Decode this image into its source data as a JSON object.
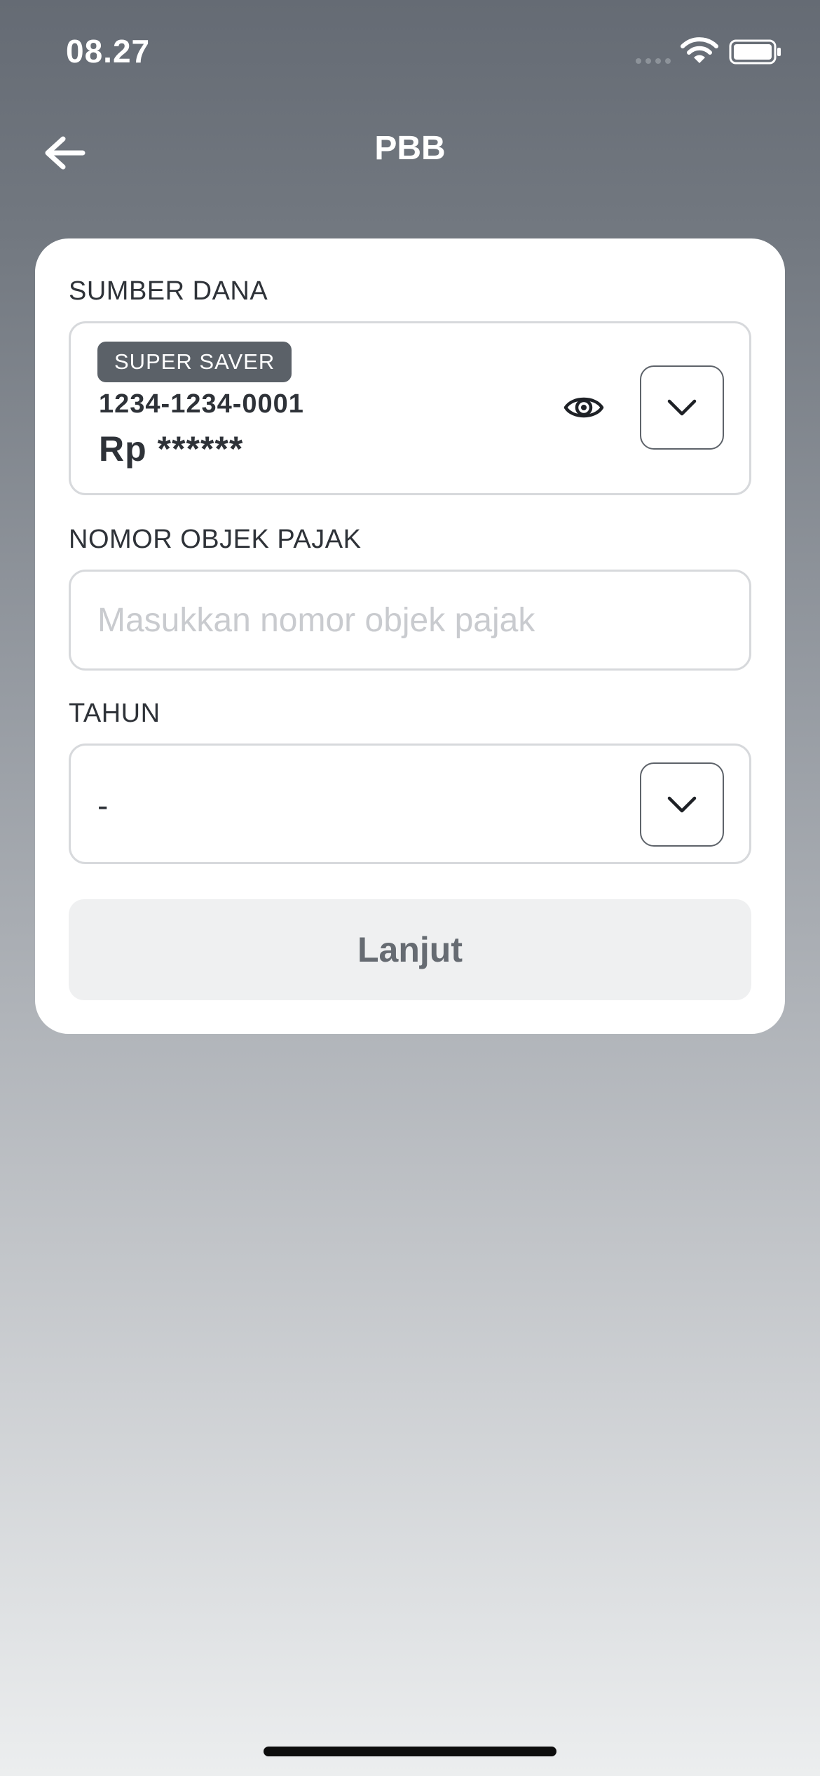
{
  "status_bar": {
    "time": "08.27"
  },
  "header": {
    "title": "PBB",
    "back_icon": "arrow-left-icon"
  },
  "form": {
    "source": {
      "label": "SUMBER DANA",
      "badge": "SUPER SAVER",
      "account_number": "1234-1234-0001",
      "balance": "Rp ******",
      "eye_icon": "eye-icon",
      "dropdown_icon": "chevron-down-icon"
    },
    "tax_object": {
      "label": "NOMOR OBJEK PAJAK",
      "value": "",
      "placeholder": "Masukkan nomor objek pajak"
    },
    "year": {
      "label": "TAHUN",
      "value": "-",
      "dropdown_icon": "chevron-down-icon"
    },
    "submit_label": "Lanjut"
  },
  "colors": {
    "badge_bg": "#5b6168",
    "button_disabled_bg": "#eff0f1",
    "button_disabled_text": "#666b72",
    "border": "#d7d9dc"
  }
}
